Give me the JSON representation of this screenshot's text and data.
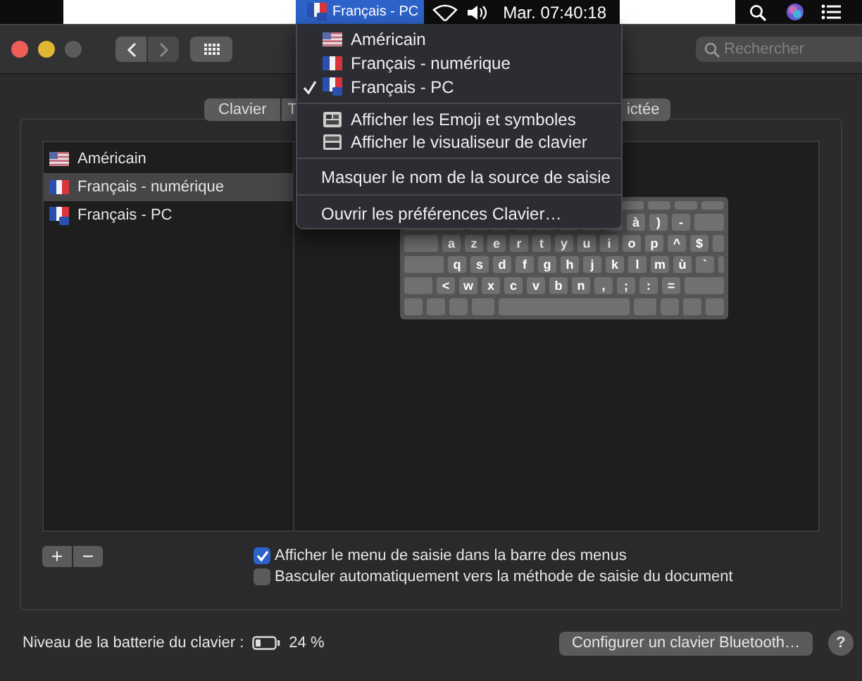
{
  "menu_bar": {
    "input_source": {
      "label": "Français - PC",
      "kind": "fr-pc"
    },
    "clock": "Mar. 07:40:18"
  },
  "window": {
    "search": {
      "placeholder": "Rechercher"
    }
  },
  "tabs": [
    {
      "label": "Clavier",
      "selected": false
    },
    {
      "label": "T",
      "selected": false
    },
    {
      "label": "ictée",
      "selected": false
    }
  ],
  "input_sources": [
    {
      "name": "Américain",
      "kind": "us",
      "selected": false
    },
    {
      "name": "Français - numérique",
      "kind": "fr",
      "selected": true
    },
    {
      "name": "Français - PC",
      "kind": "fr-pc",
      "selected": false
    }
  ],
  "keyboard": {
    "rows": [
      [
        "",
        "",
        "",
        "",
        "",
        "",
        "",
        "à",
        ")",
        "-"
      ],
      [
        "a",
        "z",
        "e",
        "r",
        "t",
        "y",
        "u",
        "i",
        "o",
        "p",
        "^",
        "$"
      ],
      [
        "q",
        "s",
        "d",
        "f",
        "g",
        "h",
        "j",
        "k",
        "l",
        "m",
        "ù",
        "`"
      ],
      [
        "<",
        "w",
        "x",
        "c",
        "v",
        "b",
        "n",
        ",",
        ";",
        ":",
        "="
      ]
    ]
  },
  "list_buttons": [
    "+",
    "−"
  ],
  "options": [
    {
      "label": "Afficher le menu de saisie dans la barre des menus",
      "checked": true
    },
    {
      "label": "Basculer automatiquement vers la méthode de saisie du document",
      "checked": false
    }
  ],
  "battery": {
    "label": "Niveau de la batterie du clavier :",
    "reading": "24 %"
  },
  "bluetooth_button": "Configurer un clavier Bluetooth…",
  "help_button": "?",
  "input_menu": {
    "sources": [
      {
        "name": "Américain",
        "kind": "us",
        "selected": false
      },
      {
        "name": "Français - numérique",
        "kind": "fr",
        "selected": false
      },
      {
        "name": "Français - PC",
        "kind": "fr-pc",
        "selected": true
      }
    ],
    "actions": [
      {
        "label": "Afficher les Emoji et symboles",
        "kind": "emoji"
      },
      {
        "label": "Afficher le visualiseur de clavier",
        "kind": "viewer"
      }
    ],
    "commands": [
      "Masquer le nom de la source de saisie",
      "Ouvrir les préférences Clavier…"
    ]
  }
}
